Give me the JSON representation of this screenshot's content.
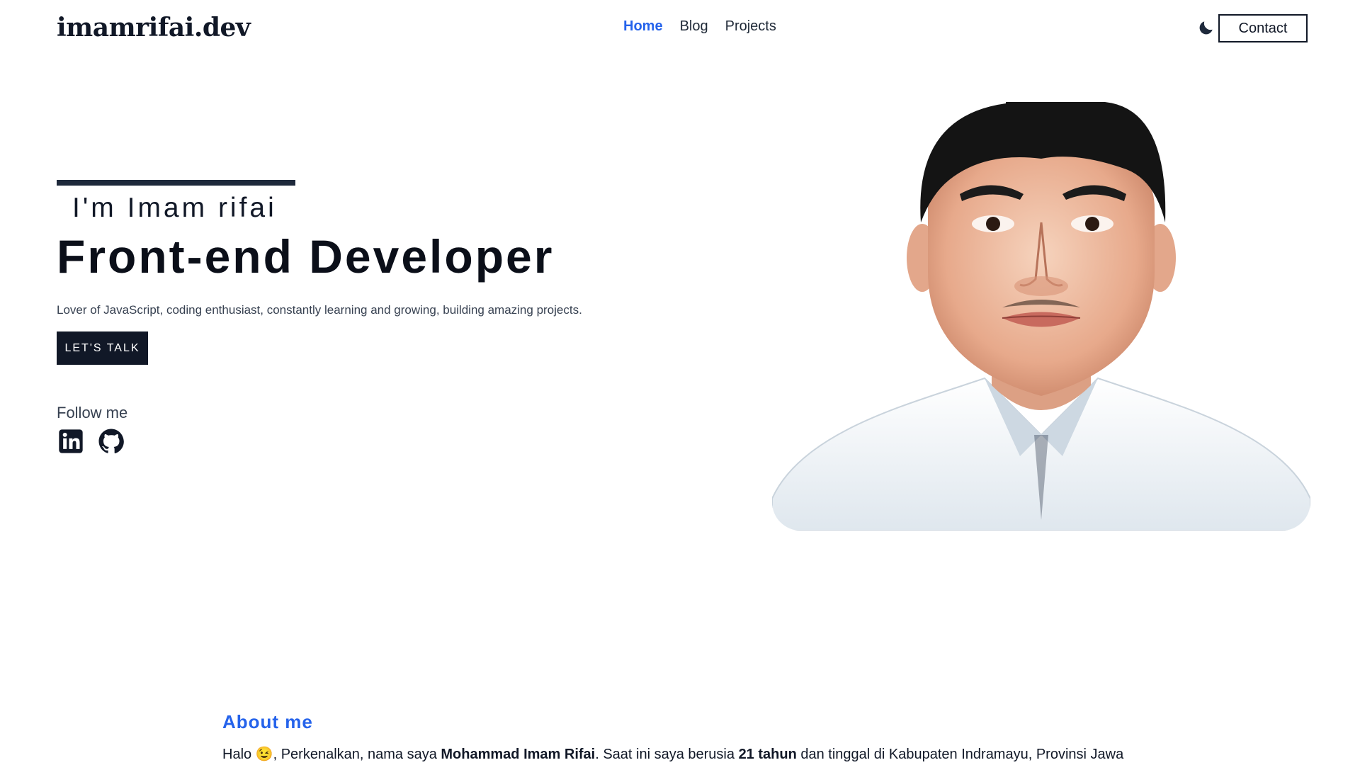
{
  "header": {
    "logo": "imamrifai.dev",
    "nav": [
      {
        "label": "Home",
        "active": true
      },
      {
        "label": "Blog",
        "active": false
      },
      {
        "label": "Projects",
        "active": false
      }
    ],
    "theme_icon": "moon-icon",
    "contact_label": "Contact"
  },
  "hero": {
    "intro": "I'm Imam rifai",
    "title": "Front-end Developer",
    "description": "Lover of JavaScript, coding enthusiast, constantly learning and growing, building amazing projects.",
    "cta_label": "LET'S TALK",
    "follow_label": "Follow me",
    "social": [
      {
        "name": "linkedin-icon"
      },
      {
        "name": "github-icon"
      }
    ]
  },
  "about": {
    "heading": "About me",
    "p1_a": "Halo 😉, Perkenalkan, nama saya ",
    "p1_name": "Mohammad Imam Rifai",
    "p1_b": ". Saat ini saya berusia ",
    "p1_age": "21 tahun",
    "p1_c": " dan tinggal di Kabupaten Indramayu, Provinsi Jawa"
  },
  "colors": {
    "accent": "#2563eb",
    "dark": "#111827"
  }
}
